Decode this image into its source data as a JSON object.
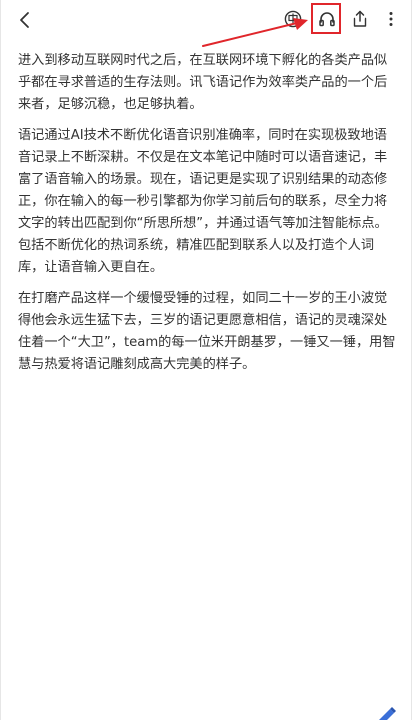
{
  "toolbar": {
    "back_icon": "chevron-left-icon",
    "translate_icon": "translate-icon",
    "listen_icon": "headphones-icon",
    "share_icon": "share-icon",
    "more_icon": "more-vertical-icon"
  },
  "annotation": {
    "highlight_color": "#e0262b"
  },
  "article": {
    "paragraphs": [
      "进入到移动互联网时代之后，在互联网环境下孵化的各类产品似乎都在寻求普适的生存法则。讯飞语记作为效率类产品的一个后来者，足够沉稳，也足够执着。",
      "语记通过AI技术不断优化语音识别准确率，同时在实现极致地语音记录上不断深耕。不仅是在文本笔记中随时可以语音速记，丰富了语音输入的场景。现在，语记更是实现了识别结果的动态修正，你在输入的每一秒引擎都为你学习前后句的联系，尽全力将文字的转出匹配到你“所思所想”，并通过语气等加注智能标点。包括不断优化的热词系统，精准匹配到联系人以及打造个人词库，让语音输入更自在。",
      "在打磨产品这样一个缓慢受锤的过程，如同二十一岁的王小波觉得他会永远生猛下去，三岁的语记更愿意相信，语记的灵魂深处住着一个“大卫”，team的每一位米开朗基罗，一锤又一锤，用智慧与热爱将语记雕刻成高大完美的样子。"
    ]
  },
  "fab": {
    "icon": "pen-icon",
    "color": "#3a6fd8"
  }
}
